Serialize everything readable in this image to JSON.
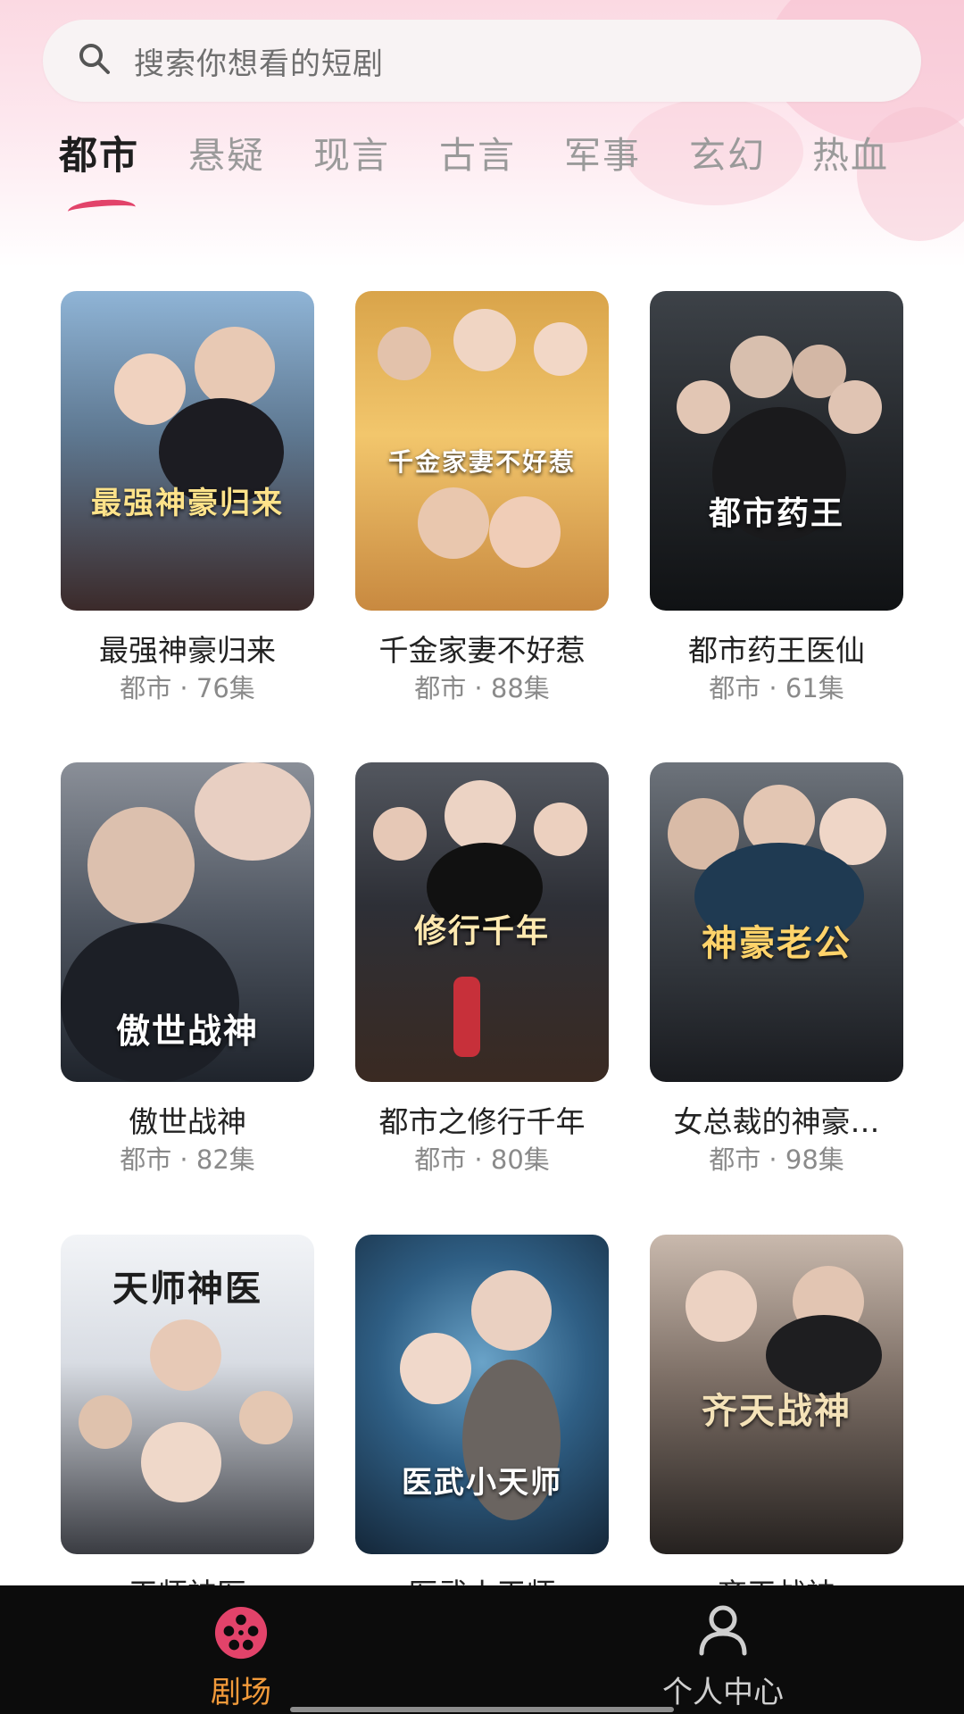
{
  "search": {
    "placeholder": "搜索你想看的短剧"
  },
  "tabs": [
    {
      "label": "都市",
      "active": true
    },
    {
      "label": "悬疑",
      "active": false
    },
    {
      "label": "现言",
      "active": false
    },
    {
      "label": "古言",
      "active": false
    },
    {
      "label": "军事",
      "active": false
    },
    {
      "label": "玄幻",
      "active": false
    },
    {
      "label": "热血",
      "active": false
    }
  ],
  "dramas": [
    {
      "title": "最强神豪归来",
      "meta": "都市 · 76集",
      "poster_text": "最强神豪归来"
    },
    {
      "title": "千金家妻不好惹",
      "meta": "都市 · 88集",
      "poster_text": "千金家妻不好惹"
    },
    {
      "title": "都市药王医仙",
      "meta": "都市 · 61集",
      "poster_text": "都市药王"
    },
    {
      "title": "傲世战神",
      "meta": "都市 · 82集",
      "poster_text": "傲世战神"
    },
    {
      "title": "都市之修行千年",
      "meta": "都市 · 80集",
      "poster_text": "修行千年"
    },
    {
      "title": "女总裁的神豪…",
      "meta": "都市 · 98集",
      "poster_text": "神豪老公"
    },
    {
      "title": "天师神医",
      "meta": "",
      "poster_text": "天师神医"
    },
    {
      "title": "医武小天师",
      "meta": "",
      "poster_text": "医武小天师"
    },
    {
      "title": "齐天战神",
      "meta": "",
      "poster_text": "齐天战神"
    }
  ],
  "bottom_nav": [
    {
      "label": "剧场",
      "icon": "film-reel-icon",
      "active": true
    },
    {
      "label": "个人中心",
      "icon": "person-icon",
      "active": false
    }
  ],
  "colors": {
    "accent": "#e2436a",
    "active_nav": "#f29a3a",
    "inactive_nav": "#cfcfcf",
    "nav_background": "#0c0c0c"
  }
}
